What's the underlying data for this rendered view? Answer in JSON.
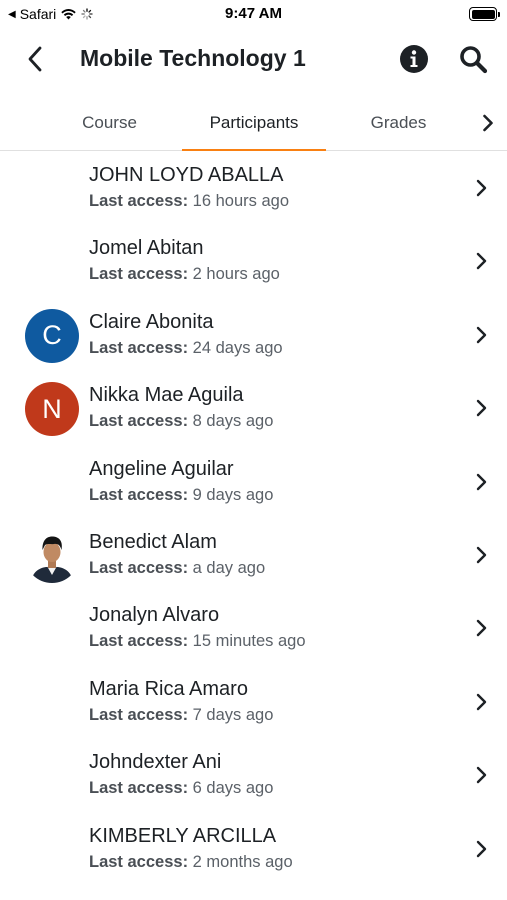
{
  "status_bar": {
    "back_app": "Safari",
    "time": "9:47 AM"
  },
  "header": {
    "title": "Mobile Technology 1"
  },
  "tabs": [
    {
      "label": "Course",
      "active": false
    },
    {
      "label": "Participants",
      "active": true
    },
    {
      "label": "Grades",
      "active": false
    }
  ],
  "colors": {
    "accent": "#f98012",
    "avatar_blue": "#0f5aa0",
    "avatar_red": "#c0391b"
  },
  "participants": [
    {
      "name": "JOHN LOYD ABALLA",
      "access_label": "Last access:",
      "access_value": "16 hours ago",
      "avatar": "none"
    },
    {
      "name": "Jomel Abitan",
      "access_label": "Last access:",
      "access_value": "2 hours ago",
      "avatar": "none"
    },
    {
      "name": "Claire Abonita",
      "access_label": "Last access:",
      "access_value": "24 days ago",
      "avatar": "initial",
      "initial": "C",
      "avatar_color": "#0f5aa0"
    },
    {
      "name": "Nikka Mae Aguila",
      "access_label": "Last access:",
      "access_value": "8 days ago",
      "avatar": "initial",
      "initial": "N",
      "avatar_color": "#c0391b"
    },
    {
      "name": "Angeline Aguilar",
      "access_label": "Last access:",
      "access_value": "9 days ago",
      "avatar": "none"
    },
    {
      "name": "Benedict Alam",
      "access_label": "Last access:",
      "access_value": "a day ago",
      "avatar": "photo"
    },
    {
      "name": "Jonalyn Alvaro",
      "access_label": "Last access:",
      "access_value": "15 minutes ago",
      "avatar": "none"
    },
    {
      "name": "Maria Rica Amaro",
      "access_label": "Last access:",
      "access_value": "7 days ago",
      "avatar": "none"
    },
    {
      "name": "Johndexter Ani",
      "access_label": "Last access:",
      "access_value": "6 days ago",
      "avatar": "none"
    },
    {
      "name": "KIMBERLY ARCILLA",
      "access_label": "Last access:",
      "access_value": "2 months ago",
      "avatar": "none"
    }
  ]
}
